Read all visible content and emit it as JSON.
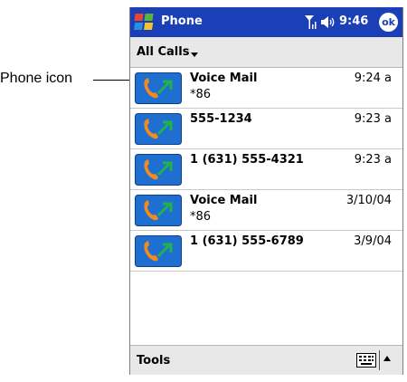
{
  "callout": {
    "label": "Phone icon"
  },
  "header": {
    "app_title": "Phone",
    "time": "9:46",
    "ok_label": "ok"
  },
  "filter": {
    "label": "All Calls"
  },
  "calls": [
    {
      "name": "Voice Mail",
      "sub": "*86",
      "time": "9:24 a"
    },
    {
      "name": "555-1234",
      "sub": "",
      "time": "9:23 a"
    },
    {
      "name": "1 (631) 555-4321",
      "sub": "",
      "time": "9:23 a"
    },
    {
      "name": "Voice Mail",
      "sub": "*86",
      "time": "3/10/04"
    },
    {
      "name": "1 (631) 555-6789",
      "sub": "",
      "time": "3/9/04"
    }
  ],
  "footer": {
    "tools_label": "Tools"
  },
  "colors": {
    "title_bar": "#1b3fb7",
    "icon_bg": "#1f6fd0",
    "handset": "#f28a1e",
    "arrow": "#22b14c"
  }
}
